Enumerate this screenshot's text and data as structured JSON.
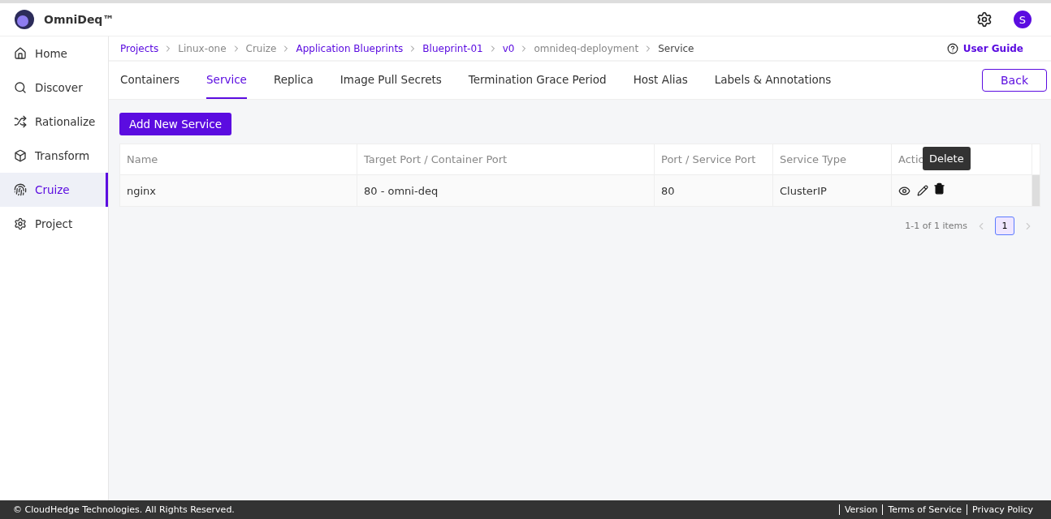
{
  "header": {
    "brand": "OmniDeq™",
    "avatar": "S"
  },
  "sidebar": {
    "items": [
      {
        "label": "Home",
        "selected": false
      },
      {
        "label": "Discover",
        "selected": false
      },
      {
        "label": "Rationalize",
        "selected": false
      },
      {
        "label": "Transform",
        "selected": false
      },
      {
        "label": "Cruize",
        "selected": true
      },
      {
        "label": "Project",
        "selected": false
      }
    ]
  },
  "breadcrumb": [
    {
      "label": "Projects",
      "kind": "link"
    },
    {
      "label": "Linux-one",
      "kind": "plain"
    },
    {
      "label": "Cruize",
      "kind": "plain"
    },
    {
      "label": "Application Blueprints",
      "kind": "link"
    },
    {
      "label": "Blueprint-01",
      "kind": "link"
    },
    {
      "label": "v0",
      "kind": "link"
    },
    {
      "label": "omnideq-deployment",
      "kind": "plain"
    },
    {
      "label": "Service",
      "kind": "current"
    }
  ],
  "user_guide": "User Guide",
  "tabs": [
    {
      "label": "Containers",
      "selected": false
    },
    {
      "label": "Service",
      "selected": true
    },
    {
      "label": "Replica",
      "selected": false
    },
    {
      "label": "Image Pull Secrets",
      "selected": false
    },
    {
      "label": "Termination Grace Period",
      "selected": false
    },
    {
      "label": "Host Alias",
      "selected": false
    },
    {
      "label": "Labels & Annotations",
      "selected": false
    }
  ],
  "back_button": "Back",
  "add_button": "Add New Service",
  "table": {
    "columns": [
      "Name",
      "Target Port / Container Port",
      "Port / Service Port",
      "Service Type",
      "Actio"
    ],
    "rows": [
      {
        "cells": [
          "nginx",
          "80 - omni-deq",
          "80",
          "ClusterIP"
        ]
      }
    ]
  },
  "tooltip": "Delete",
  "pagination": {
    "summary": "1-1 of 1 items",
    "pages": [
      {
        "label": "1",
        "selected": true
      }
    ],
    "prev_disabled": true,
    "next_disabled": true
  },
  "footer": {
    "copyright": "© CloudHedge Technologies. All Rights Reserved.",
    "links": [
      "Version",
      "Terms of Service",
      "Privacy Policy"
    ]
  }
}
